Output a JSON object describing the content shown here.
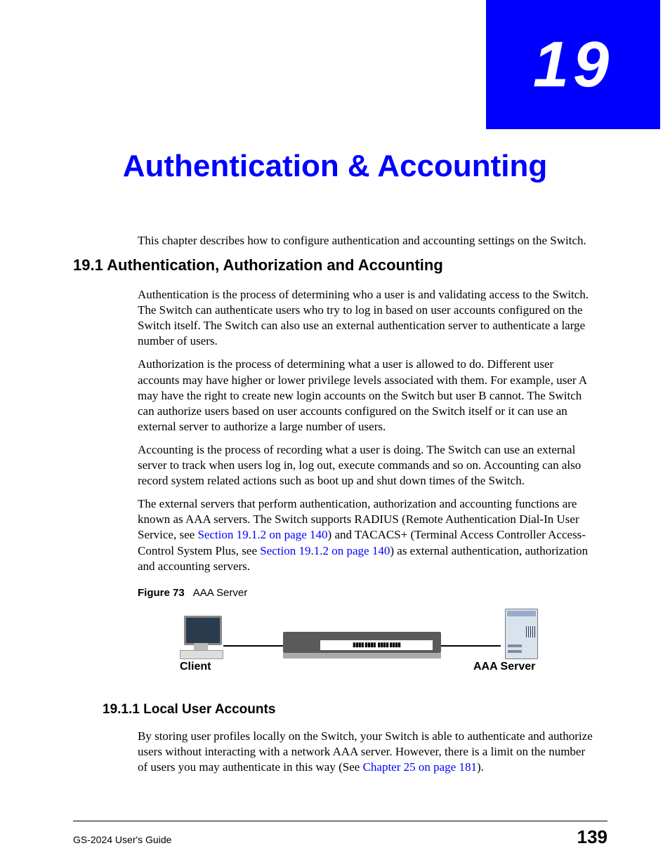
{
  "chapter": {
    "number": "19",
    "title": "Authentication & Accounting"
  },
  "intro": "This chapter describes how to configure authentication and accounting settings on the Switch.",
  "section1": {
    "heading": "19.1  Authentication, Authorization and Accounting",
    "p1": "Authentication is the process of determining who a user is and validating access to the Switch. The Switch can authenticate users who try to log in based on user accounts configured on the Switch itself. The Switch can also use an external authentication server to authenticate a large number of users.",
    "p2": "Authorization is the process of determining what a user is allowed to do. Different user accounts may have higher or lower privilege levels associated with them. For example, user A may have the right to create new login accounts on the Switch but user B cannot. The Switch can authorize users based on user accounts configured on the Switch itself or it can use an external server to authorize a large number of users.",
    "p3": "Accounting is the process of recording what a user is doing. The Switch can use an external server to track when users log in, log out, execute commands and so on. Accounting can also record system related actions such as boot up and shut down times of the Switch.",
    "p4_a": "The external servers that perform authentication, authorization and accounting functions are known as AAA servers. The Switch supports RADIUS (Remote Authentication Dial-In User Service, see ",
    "p4_xref1": "Section 19.1.2 on page 140",
    "p4_b": ") and TACACS+ (Terminal Access Controller Access-Control System Plus, see ",
    "p4_xref2": "Section 19.1.2 on page 140",
    "p4_c": ") as external authentication, authorization and accounting servers."
  },
  "figure": {
    "label": "Figure 73",
    "caption": "AAA Server",
    "client_label": "Client",
    "server_label": "AAA Server"
  },
  "section11": {
    "heading": "19.1.1  Local User Accounts",
    "p1_a": "By storing user profiles locally on the Switch, your Switch is able to authenticate and authorize users without interacting with a network AAA server. However, there is a limit on the number of users you may authenticate in this way (See ",
    "p1_xref": "Chapter 25 on page 181",
    "p1_b": ")."
  },
  "footer": {
    "guide": "GS-2024 User's Guide",
    "page": "139"
  }
}
